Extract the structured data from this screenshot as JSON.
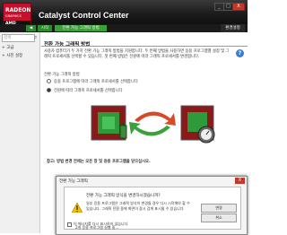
{
  "window": {
    "title": "Catalyst Control Center",
    "logo_brand": "RADEON",
    "logo_sub": "GRAPHICS",
    "logo_vendor": "AMD",
    "controls": {
      "minimize": "_",
      "maximize": "□",
      "close": "X"
    }
  },
  "toolbar": {
    "preferences": "환경설정"
  },
  "nav": {
    "back": "◀",
    "home": "시작",
    "breadcrumb": "전환 가능 그래픽 방법"
  },
  "sidebar": {
    "search_placeholder": "검색",
    "items": [
      {
        "label": "+ 고급"
      },
      {
        "label": "+ 사진 설정"
      }
    ]
  },
  "page": {
    "title": "전환 가능 그래픽 방법",
    "description": "사용자 컴퓨터가 두 가지 전환 가능 그래픽 방법을 지원합니다. 두 번째 방법을 사용하면 응용 프로그램별 설정 및 그래픽 프로세서를 선택할 수 있습니다. 첫 번째 방법은 전원에 따라 그래픽 프로세서를 변경합니다.",
    "group_label": "전환 가능 그래픽 방법",
    "options": [
      {
        "label": "응용 프로그램에 따라 그래픽 프로세서를 선택합니다",
        "selected": false
      },
      {
        "label": "전원에 따라 그래픽 프로세서를 선택합니다",
        "selected": true
      }
    ],
    "footnote": "참고: 방법 변경 전에는 모든 창 및 응용 프로그램을 닫으십시오.",
    "help_icon": "?"
  },
  "dialog": {
    "title": "전환 가능 그래픽",
    "close": "X",
    "heading": "전환 가능 그래픽 방식을 변경하시겠습니까?",
    "body": "일부 응용 프로그램은 그래픽 방식이 변경될 경우 다시 시작해야 할 수 있습니다. 그래픽 전환 중에 화면이 잠시 검게 표시될 수 있습니다.",
    "buttons": {
      "change": "변경",
      "cancel": "취소"
    },
    "status": "2개 응용 프로그램 실행 중...",
    "checkbox": "이 메시지를 다시 표시하지 않습니다."
  },
  "colors": {
    "accent_green": "#2d8a2d",
    "logo_red": "#c8102e"
  }
}
